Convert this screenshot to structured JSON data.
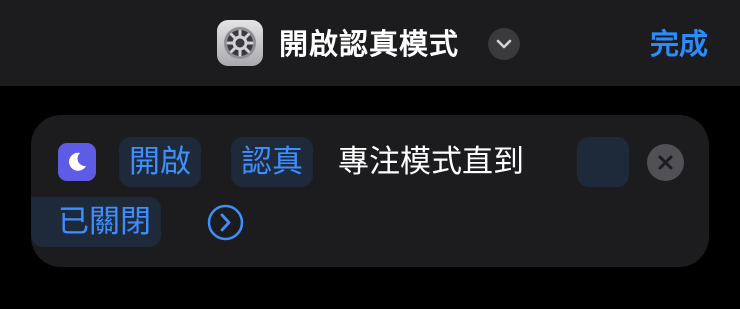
{
  "header": {
    "app_icon": "settings-gear-icon",
    "title": "開啟認真模式",
    "title_chevron_icon": "chevron-down-icon",
    "done_label": "完成",
    "accent_color": "#2a8cff",
    "background_color": "#1c1c1e"
  },
  "action": {
    "icon": "moon-icon",
    "icon_color": "#5e5ce6",
    "verb_token": "開啟",
    "focus_token": "認真",
    "text_middle": "專注模式直到",
    "until_token": "",
    "condition_token": "已關閉",
    "expand_icon": "chevron-right-circle-icon",
    "clear_icon": "close-circle-icon",
    "token_color": "#3d8fff"
  }
}
